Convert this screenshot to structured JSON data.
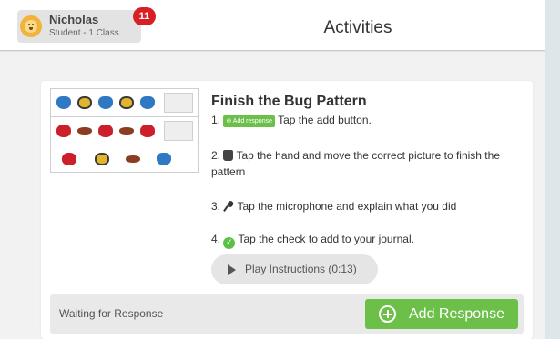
{
  "header": {
    "user_name": "Nicholas",
    "user_subtitle": "Student - 1 Class",
    "notification_count": "11",
    "page_title": "Activities"
  },
  "activity": {
    "title": "Finish the Bug Pattern",
    "steps": [
      {
        "num": "1.",
        "badge": "⊕ Add response",
        "text": "Tap the add button."
      },
      {
        "num": "2.",
        "text": "Tap the hand and move the correct picture to finish the pattern"
      },
      {
        "num": "3.",
        "text": "Tap the microphone and explain what you did"
      },
      {
        "num": "4.",
        "text": "Tap the check to add to your journal."
      }
    ],
    "play_label": "Play Instructions (0:13)",
    "pattern_rows": [
      [
        "butterfly",
        "bee",
        "butterfly",
        "bee",
        "butterfly",
        "blank"
      ],
      [
        "ladybug",
        "ant",
        "ladybug",
        "ant",
        "ladybug",
        "blank"
      ],
      [
        "ladybug",
        "bee",
        "ant",
        "butterfly"
      ]
    ]
  },
  "footer": {
    "status": "Waiting for Response",
    "add_label": "Add Response"
  },
  "colors": {
    "accent_green": "#6cc04a",
    "badge_red": "#d81f26",
    "frame_blue": "#dde7eb"
  }
}
